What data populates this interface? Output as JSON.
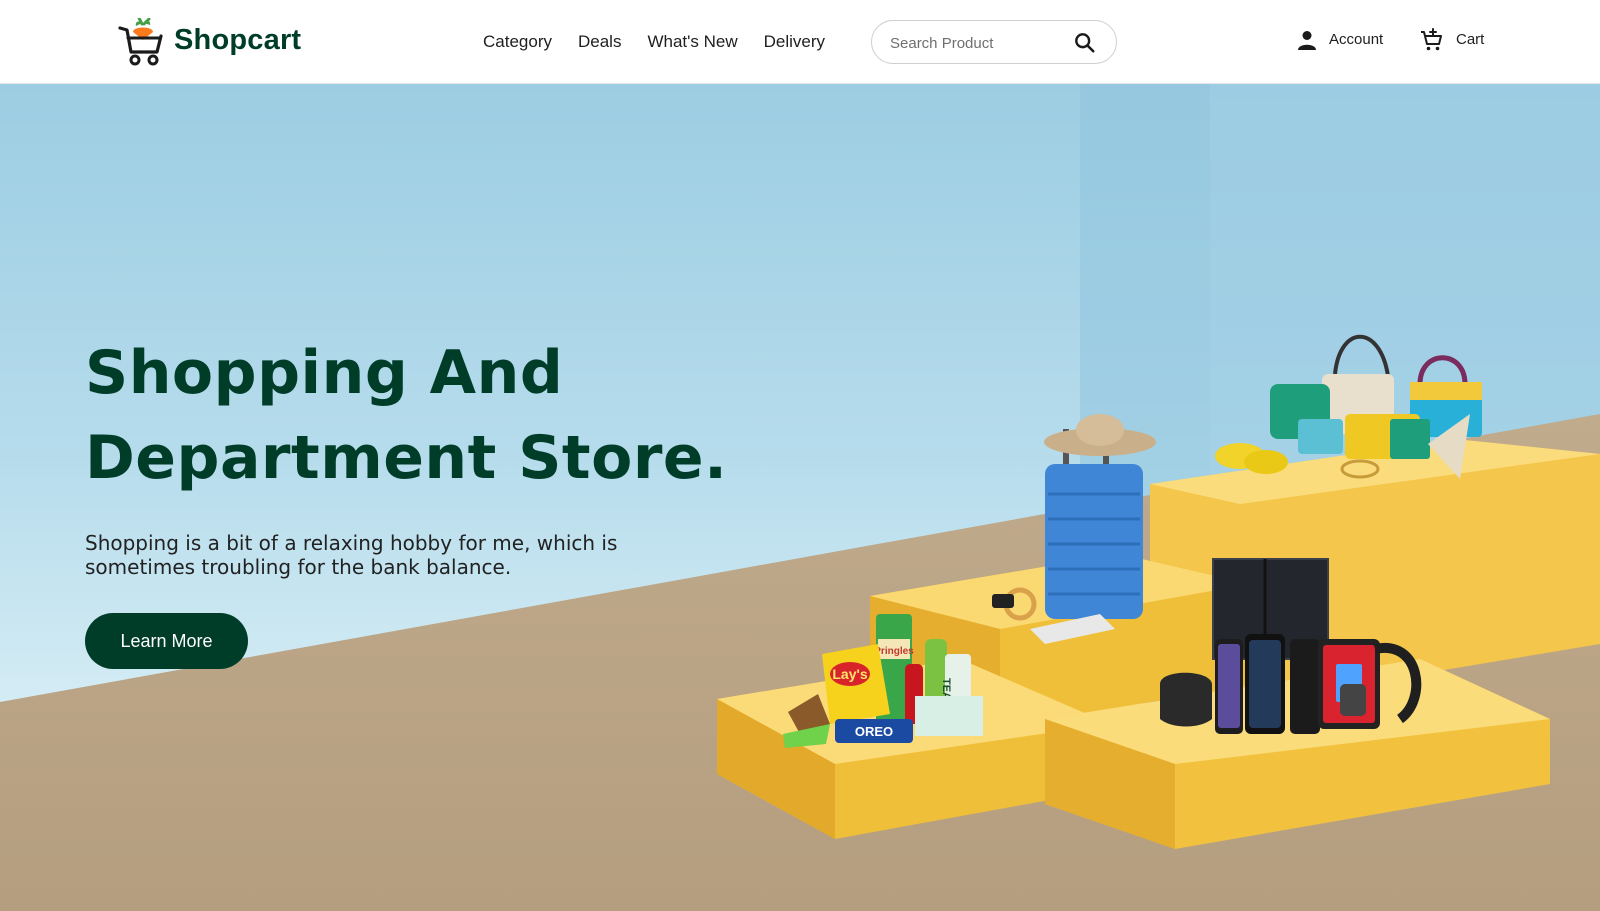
{
  "header": {
    "logo": {
      "text": "Shopcart",
      "icon": "cart-carrot-icon",
      "color": "#003d29"
    },
    "nav": [
      {
        "label": "Category"
      },
      {
        "label": "Deals"
      },
      {
        "label": "What's New"
      },
      {
        "label": "Delivery"
      }
    ],
    "search": {
      "placeholder": "Search Product",
      "value": "",
      "icon": "search-icon"
    },
    "account": {
      "label": "Account",
      "icon": "user-icon"
    },
    "cart": {
      "label": "Cart",
      "icon": "cart-add-icon"
    }
  },
  "hero": {
    "title": "Shopping And Department Store.",
    "description": "Shopping is a bit of a relaxing hobby for me, which is sometimes troubling for the bank balance.",
    "button_label": "Learn More",
    "illustration": "product-podium-illustration",
    "products": {
      "snacks": {
        "lays": "Lay's",
        "pringles": "Pringles",
        "oreo": "OREO",
        "tea": "TEA"
      }
    }
  },
  "colors": {
    "brand": "#003d29",
    "sky": "#a9d5e8",
    "floor": "#bfa98a",
    "podium": "#f5c844"
  }
}
